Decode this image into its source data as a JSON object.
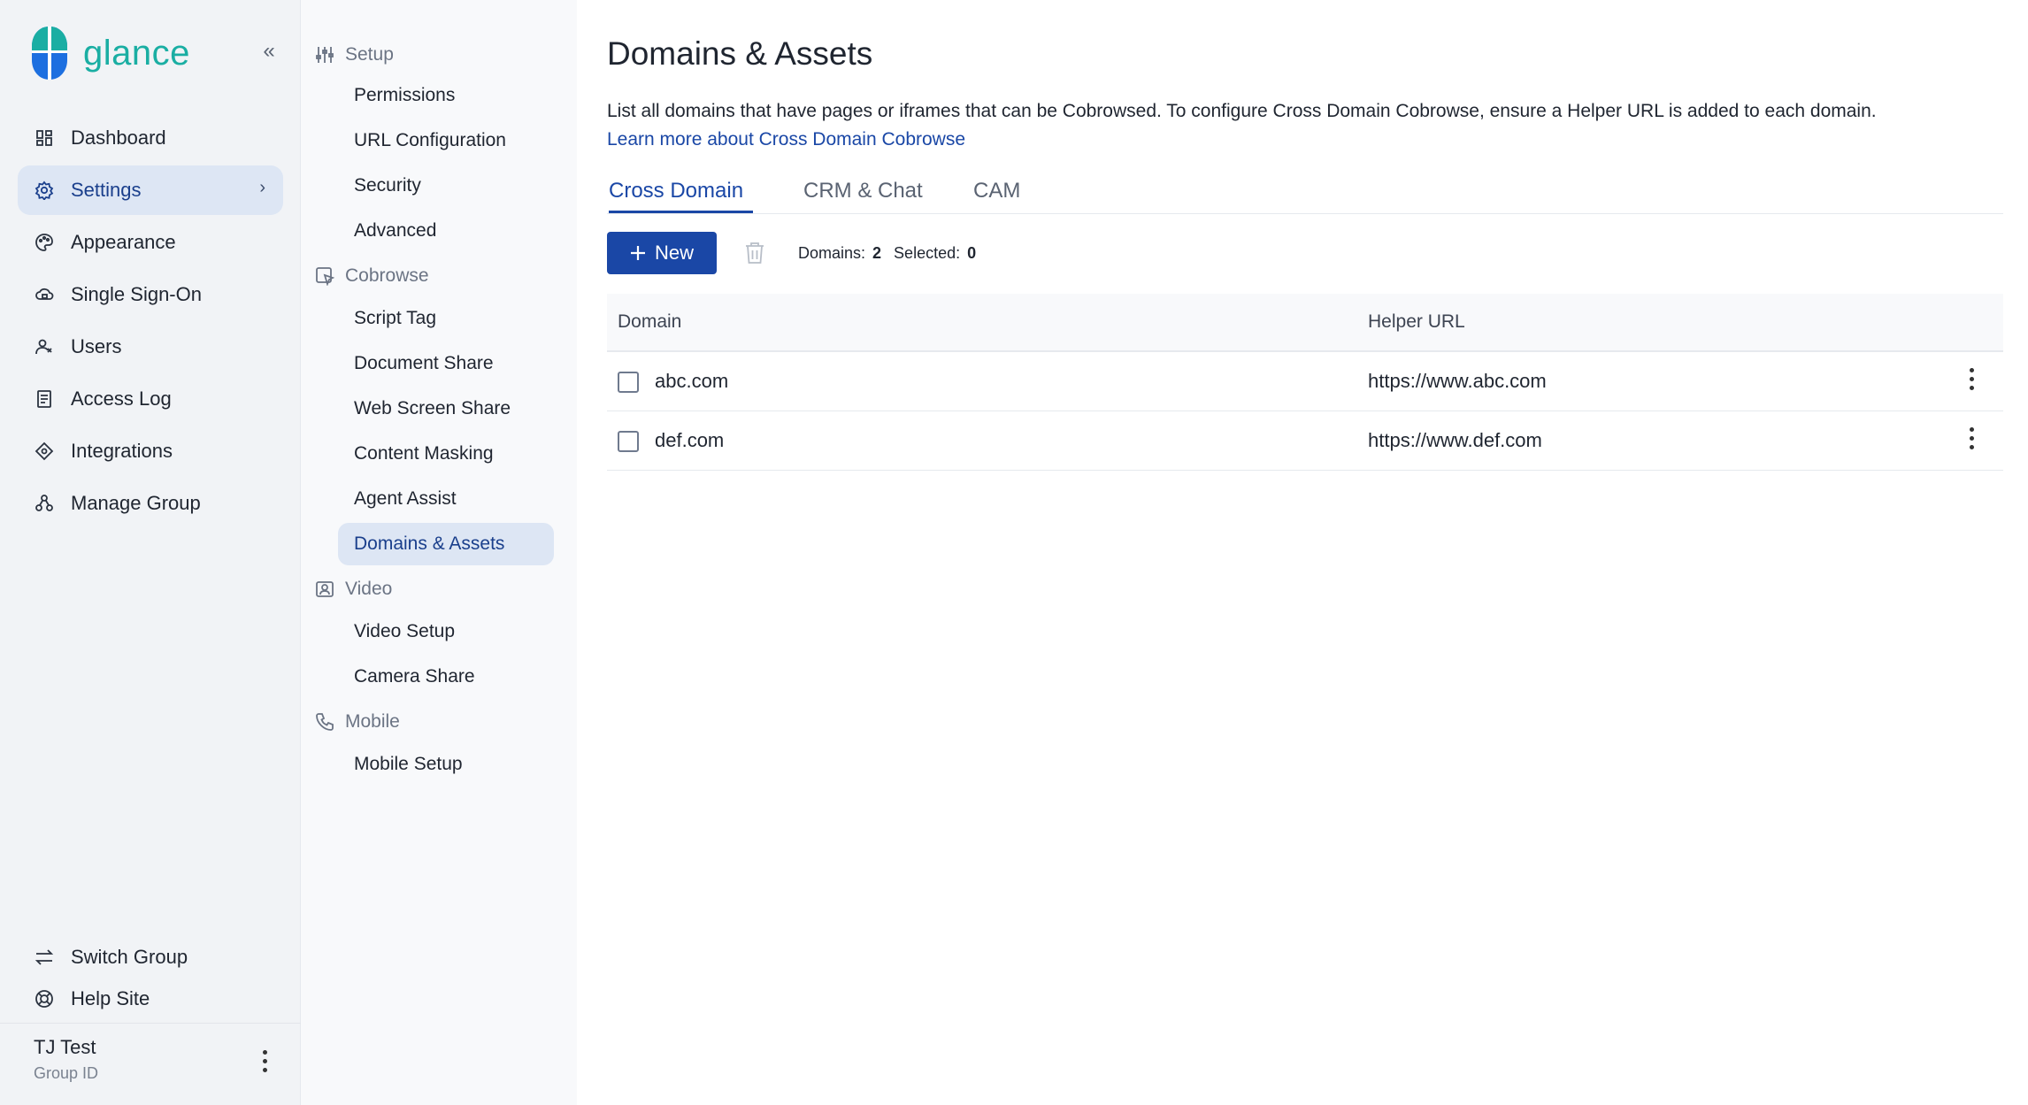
{
  "brand": {
    "name": "glance",
    "color": "#1aaea3",
    "accent": "#1a47a6"
  },
  "nav": {
    "collapse_icon": "chevrons-left-icon",
    "items": [
      {
        "label": "Dashboard",
        "icon": "dashboard-icon"
      },
      {
        "label": "Settings",
        "icon": "gear-icon",
        "active": true
      },
      {
        "label": "Appearance",
        "icon": "palette-icon"
      },
      {
        "label": "Single Sign-On",
        "icon": "cloud-lock-icon"
      },
      {
        "label": "Users",
        "icon": "users-icon"
      },
      {
        "label": "Access Log",
        "icon": "log-icon"
      },
      {
        "label": "Integrations",
        "icon": "integrations-icon"
      },
      {
        "label": "Manage Group",
        "icon": "group-icon"
      }
    ],
    "bottom": [
      {
        "label": "Switch Group",
        "icon": "switch-icon"
      },
      {
        "label": "Help Site",
        "icon": "lifebuoy-icon"
      }
    ],
    "user": {
      "name": "TJ Test",
      "sub": "Group ID"
    }
  },
  "subnav": {
    "sections": [
      {
        "title": "Setup",
        "icon": "sliders-icon",
        "items": [
          "Permissions",
          "URL Configuration",
          "Security",
          "Advanced"
        ]
      },
      {
        "title": "Cobrowse",
        "icon": "cobrowse-icon",
        "items": [
          "Script Tag",
          "Document Share",
          "Web Screen Share",
          "Content Masking",
          "Agent Assist",
          "Domains & Assets"
        ]
      },
      {
        "title": "Video",
        "icon": "video-icon",
        "items": [
          "Video Setup",
          "Camera Share"
        ]
      },
      {
        "title": "Mobile",
        "icon": "phone-icon",
        "items": [
          "Mobile Setup"
        ]
      }
    ],
    "active": "Domains & Assets"
  },
  "main": {
    "title": "Domains & Assets",
    "description": "List all domains that have pages or iframes that can be Cobrowsed. To configure Cross Domain Cobrowse, ensure a Helper URL is added to each domain.",
    "learn_more": "Learn more about Cross Domain Cobrowse",
    "tabs": [
      "Cross Domain",
      "CRM & Chat",
      "CAM"
    ],
    "active_tab": "Cross Domain",
    "new_button": "New",
    "counts": {
      "domains_label": "Domains:",
      "domains": "2",
      "selected_label": "Selected:",
      "selected": "0"
    },
    "table": {
      "headers": [
        "Domain",
        "Helper URL"
      ],
      "rows": [
        {
          "domain": "abc.com",
          "url": "https://www.abc.com"
        },
        {
          "domain": "def.com",
          "url": "https://www.def.com"
        }
      ]
    }
  }
}
